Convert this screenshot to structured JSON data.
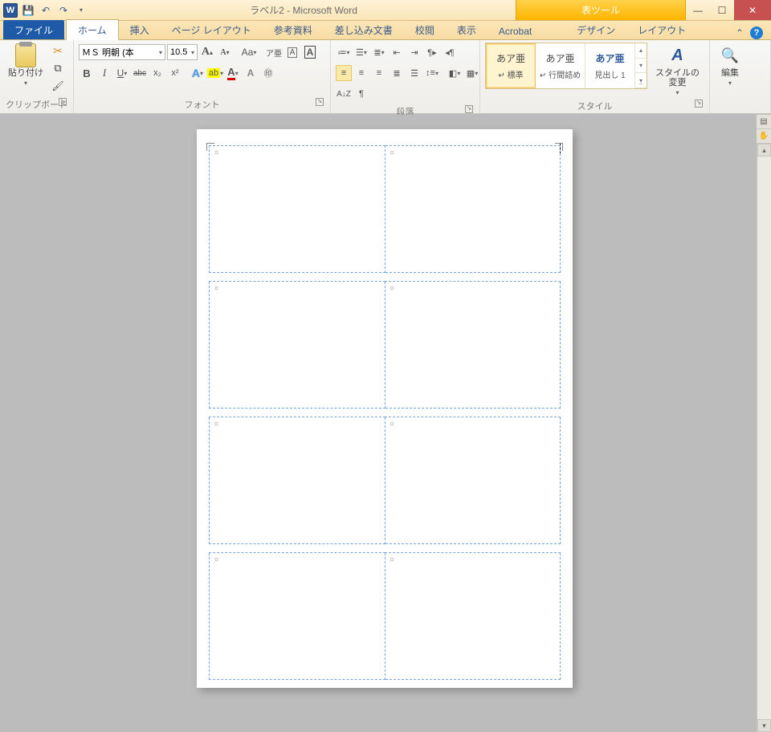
{
  "title": "ラベル2  -  Microsoft Word",
  "app_letter": "W",
  "qat": {
    "save": "save",
    "undo": "undo",
    "redo": "redo",
    "customize": "customize"
  },
  "tool_tab": "表ツール",
  "win": {
    "min": "—",
    "max": "☐",
    "close": "✕"
  },
  "tabs": {
    "file": "ファイル",
    "items": [
      "ホーム",
      "挿入",
      "ページ レイアウト",
      "参考資料",
      "差し込み文書",
      "校閲",
      "表示",
      "Acrobat"
    ],
    "contextual": [
      "デザイン",
      "レイアウト"
    ],
    "collapse": "⌃"
  },
  "ribbon": {
    "clipboard": {
      "label": "クリップボード",
      "paste": "貼り付け"
    },
    "font": {
      "label": "フォント",
      "name": "ＭＳ 明朝 (本",
      "size": "10.5",
      "grow": "A",
      "shrink": "A",
      "case": "Aa",
      "bold": "B",
      "italic": "I",
      "underline": "U",
      "strike": "abc",
      "sub": "x₂",
      "sup": "x²",
      "effects": "A",
      "highlight": "ab",
      "color": "A",
      "enclose": "A",
      "clear": "A⃠",
      "ruby": "ア亜"
    },
    "paragraph": {
      "label": "段落"
    },
    "styles": {
      "label": "スタイル",
      "items": [
        {
          "preview": "あア亜",
          "name": "↵ 標準"
        },
        {
          "preview": "あア亜",
          "name": "↵ 行間詰め"
        },
        {
          "preview": "あア亜",
          "name": "見出し 1"
        }
      ],
      "change": "スタイルの\n変更"
    },
    "editing": {
      "label": "編集",
      "find": "編集"
    }
  },
  "doc": {
    "cell_mark": "¤"
  }
}
